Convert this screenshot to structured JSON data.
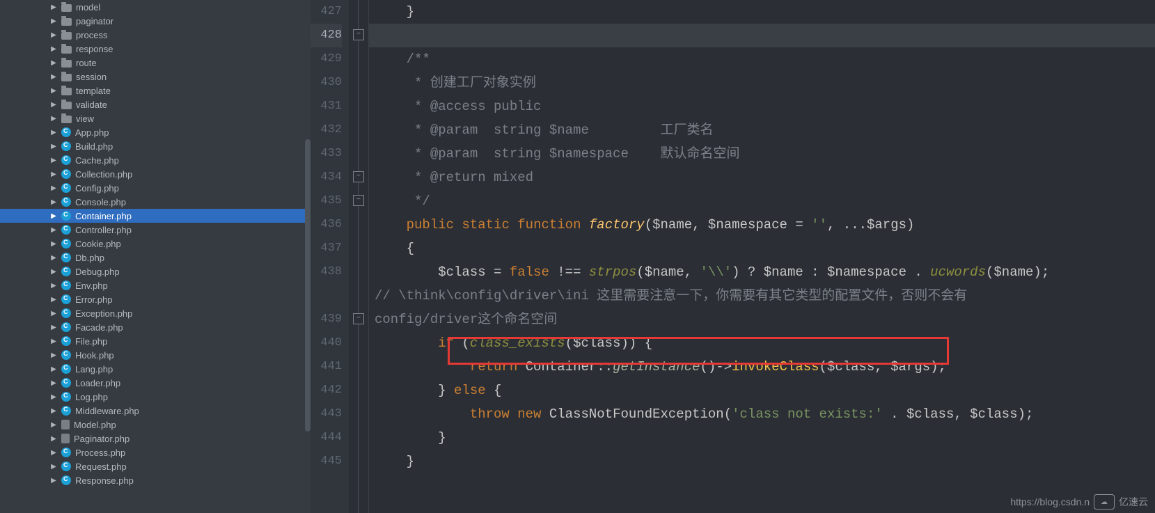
{
  "sidebar": {
    "items": [
      {
        "type": "folder",
        "label": "model"
      },
      {
        "type": "folder",
        "label": "paginator"
      },
      {
        "type": "folder",
        "label": "process"
      },
      {
        "type": "folder",
        "label": "response"
      },
      {
        "type": "folder",
        "label": "route"
      },
      {
        "type": "folder",
        "label": "session"
      },
      {
        "type": "folder",
        "label": "template"
      },
      {
        "type": "folder",
        "label": "validate"
      },
      {
        "type": "folder",
        "label": "view"
      },
      {
        "type": "php",
        "label": "App.php"
      },
      {
        "type": "php",
        "label": "Build.php"
      },
      {
        "type": "php",
        "label": "Cache.php"
      },
      {
        "type": "php",
        "label": "Collection.php"
      },
      {
        "type": "php",
        "label": "Config.php"
      },
      {
        "type": "php",
        "label": "Console.php"
      },
      {
        "type": "php",
        "label": "Container.php",
        "selected": true
      },
      {
        "type": "php",
        "label": "Controller.php"
      },
      {
        "type": "php",
        "label": "Cookie.php"
      },
      {
        "type": "php",
        "label": "Db.php"
      },
      {
        "type": "php",
        "label": "Debug.php"
      },
      {
        "type": "php",
        "label": "Env.php"
      },
      {
        "type": "php",
        "label": "Error.php"
      },
      {
        "type": "php",
        "label": "Exception.php"
      },
      {
        "type": "php",
        "label": "Facade.php"
      },
      {
        "type": "php",
        "label": "File.php"
      },
      {
        "type": "php",
        "label": "Hook.php"
      },
      {
        "type": "php",
        "label": "Lang.php"
      },
      {
        "type": "php",
        "label": "Loader.php"
      },
      {
        "type": "php",
        "label": "Log.php"
      },
      {
        "type": "php",
        "label": "Middleware.php"
      },
      {
        "type": "php2",
        "label": "Model.php"
      },
      {
        "type": "php2",
        "label": "Paginator.php"
      },
      {
        "type": "php",
        "label": "Process.php"
      },
      {
        "type": "php",
        "label": "Request.php"
      },
      {
        "type": "php",
        "label": "Response.php"
      }
    ]
  },
  "editor": {
    "lines": [
      "427",
      "428",
      "429",
      "430",
      "431",
      "432",
      "433",
      "434",
      "435",
      "436",
      "437",
      "438",
      "439",
      "440",
      "441",
      "442",
      "443",
      "444",
      "445"
    ],
    "highlighted_line": "428",
    "code": {
      "l1": "    }",
      "l2": "",
      "l3": "    /**",
      "l4_a": "     * ",
      "l4_b": "创建工厂对象实例",
      "l5": "     * @access public",
      "l6_a": "     * @param  string $name         ",
      "l6_b": "工厂类名",
      "l7_a": "     * @param  string $namespace    ",
      "l7_b": "默认命名空间",
      "l8": "     * @return mixed",
      "l9": "     */",
      "l10_public": "public",
      "l10_static": "static",
      "l10_function": "function",
      "l10_name": "factory",
      "l10_params": "($name, $namespace = ",
      "l10_str": "''",
      "l10_rest": ", ...$args)",
      "l11": "    {",
      "l12_a": "        $class = ",
      "l12_false": "false",
      "l12_b": " !== ",
      "l12_fn": "strpos",
      "l12_c": "($name, ",
      "l12_str": "'\\\\'",
      "l12_d": ") ? $name : $namespace . ",
      "l12_uc": "ucwords",
      "l12_e": "($name);",
      "l13_a": "        // \\think\\config\\driver\\ini  ",
      "l13_b": "这里需要注意一下，你需要有其它类型的配置文件，否则不会有",
      "l13_c": "config/driver这个命名空间",
      "l14_if": "if",
      "l14_a": " (",
      "l14_fn": "class_exists",
      "l14_b": "($class)) {",
      "l15_ret": "return",
      "l15_a": " Container::",
      "l15_get": "getInstance",
      "l15_b": "()->",
      "l15_inv": "invokeClass",
      "l15_c": "($class, $args);",
      "l16_a": "        } ",
      "l16_else": "else",
      "l16_b": " {",
      "l17_throw": "throw",
      "l17_new": "new",
      "l17_a": " ClassNotFoundException(",
      "l17_str": "'class not exists:'",
      "l17_b": " . $class, $class);",
      "l18": "        }",
      "l19": "    }",
      "l20": ""
    }
  },
  "watermark": {
    "url": "https://blog.csdn.n",
    "brand": "亿速云"
  }
}
